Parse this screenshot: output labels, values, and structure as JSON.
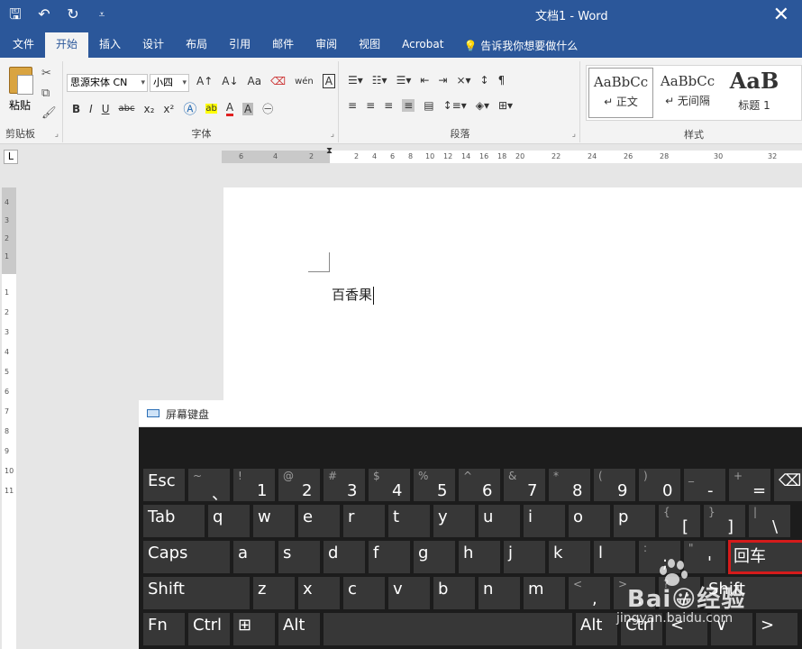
{
  "window": {
    "doc_title": "文档1",
    "separator": "-",
    "app_name": "Word"
  },
  "quick_access": {
    "save_icon": "save-icon",
    "undo_icon": "undo-icon",
    "redo_icon": "redo-icon",
    "customize_icon": "chevron-down-icon"
  },
  "tabs": [
    {
      "label": "文件"
    },
    {
      "label": "开始"
    },
    {
      "label": "插入"
    },
    {
      "label": "设计"
    },
    {
      "label": "布局"
    },
    {
      "label": "引用"
    },
    {
      "label": "邮件"
    },
    {
      "label": "审阅"
    },
    {
      "label": "视图"
    },
    {
      "label": "Acrobat"
    }
  ],
  "tell_me": "告诉我你想要做什么",
  "ribbon": {
    "clipboard": {
      "paste": "粘贴",
      "group": "剪贴板"
    },
    "font": {
      "family": "思源宋体 CN",
      "size": "小四",
      "group": "字体",
      "bold": "B",
      "italic": "I",
      "underline": "U",
      "strike": "abc",
      "sub": "x₂",
      "sup": "x²",
      "grow": "A↑",
      "shrink": "A↓",
      "case": "Aa",
      "char_border": "A",
      "phonetic": "wén",
      "font_color": "A",
      "highlight": "ab"
    },
    "paragraph": {
      "group": "段落"
    },
    "styles": {
      "group": "样式",
      "items": [
        {
          "sample": "AaBbCc",
          "name": "↵ 正文"
        },
        {
          "sample": "AaBbCc",
          "name": "↵ 无间隔"
        },
        {
          "sample": "AaB",
          "name": "标题 1"
        }
      ]
    }
  },
  "ruler": {
    "h_ticks": [
      "6",
      "4",
      "2",
      "2",
      "4",
      "6",
      "8",
      "10",
      "12",
      "14",
      "16",
      "18",
      "20",
      "22",
      "24",
      "26",
      "28",
      "30",
      "32"
    ],
    "v_ticks": [
      "4",
      "3",
      "2",
      "1",
      "1",
      "2",
      "3",
      "4",
      "5",
      "6",
      "7",
      "8",
      "9",
      "10",
      "11"
    ],
    "tab_stop": "L"
  },
  "document": {
    "text": "百香果"
  },
  "osk": {
    "title": "屏幕键盘",
    "rows": [
      [
        {
          "main": "Esc"
        },
        {
          "sec": "~",
          "pri": "、"
        },
        {
          "sec": "!",
          "pri": "1"
        },
        {
          "sec": "@",
          "pri": "2"
        },
        {
          "sec": "#",
          "pri": "3"
        },
        {
          "sec": "$",
          "pri": "4"
        },
        {
          "sec": "%",
          "pri": "5"
        },
        {
          "sec": "^",
          "pri": "6"
        },
        {
          "sec": "&",
          "pri": "7"
        },
        {
          "sec": "*",
          "pri": "8"
        },
        {
          "sec": "(",
          "pri": "9"
        },
        {
          "sec": ")",
          "pri": "0"
        },
        {
          "sec": "_",
          "pri": "-"
        },
        {
          "sec": "+",
          "pri": "="
        },
        {
          "main": "⌫"
        }
      ],
      [
        {
          "main": "Tab"
        },
        {
          "main": "q"
        },
        {
          "main": "w"
        },
        {
          "main": "e"
        },
        {
          "main": "r"
        },
        {
          "main": "t"
        },
        {
          "main": "y"
        },
        {
          "main": "u"
        },
        {
          "main": "i"
        },
        {
          "main": "o"
        },
        {
          "main": "p"
        },
        {
          "sec": "{",
          "pri": "["
        },
        {
          "sec": "}",
          "pri": "]"
        },
        {
          "sec": "|",
          "pri": "\\"
        }
      ],
      [
        {
          "main": "Caps"
        },
        {
          "main": "a"
        },
        {
          "main": "s"
        },
        {
          "main": "d"
        },
        {
          "main": "f"
        },
        {
          "main": "g"
        },
        {
          "main": "h"
        },
        {
          "main": "j"
        },
        {
          "main": "k"
        },
        {
          "main": "l"
        },
        {
          "sec": ":",
          "pri": ";"
        },
        {
          "sec": "\"",
          "pri": "'"
        },
        {
          "main": "回车"
        }
      ],
      [
        {
          "main": "Shift"
        },
        {
          "main": "z"
        },
        {
          "main": "x"
        },
        {
          "main": "c"
        },
        {
          "main": "v"
        },
        {
          "main": "b"
        },
        {
          "main": "n"
        },
        {
          "main": "m"
        },
        {
          "sec": "<",
          "pri": ","
        },
        {
          "sec": ">",
          "pri": "."
        },
        {
          "sec": "?",
          "pri": "/"
        },
        {
          "main": "Shift"
        }
      ],
      [
        {
          "main": "Fn"
        },
        {
          "main": "Ctrl"
        },
        {
          "main": "⊞"
        },
        {
          "main": "Alt"
        },
        {
          "main": ""
        },
        {
          "main": "Alt"
        },
        {
          "main": "Ctrl"
        },
        {
          "main": "<"
        },
        {
          "main": "∨"
        },
        {
          "main": ">"
        }
      ]
    ]
  },
  "watermark": {
    "brand": "Bai😀经验",
    "url": "jingyan.baidu.com"
  }
}
